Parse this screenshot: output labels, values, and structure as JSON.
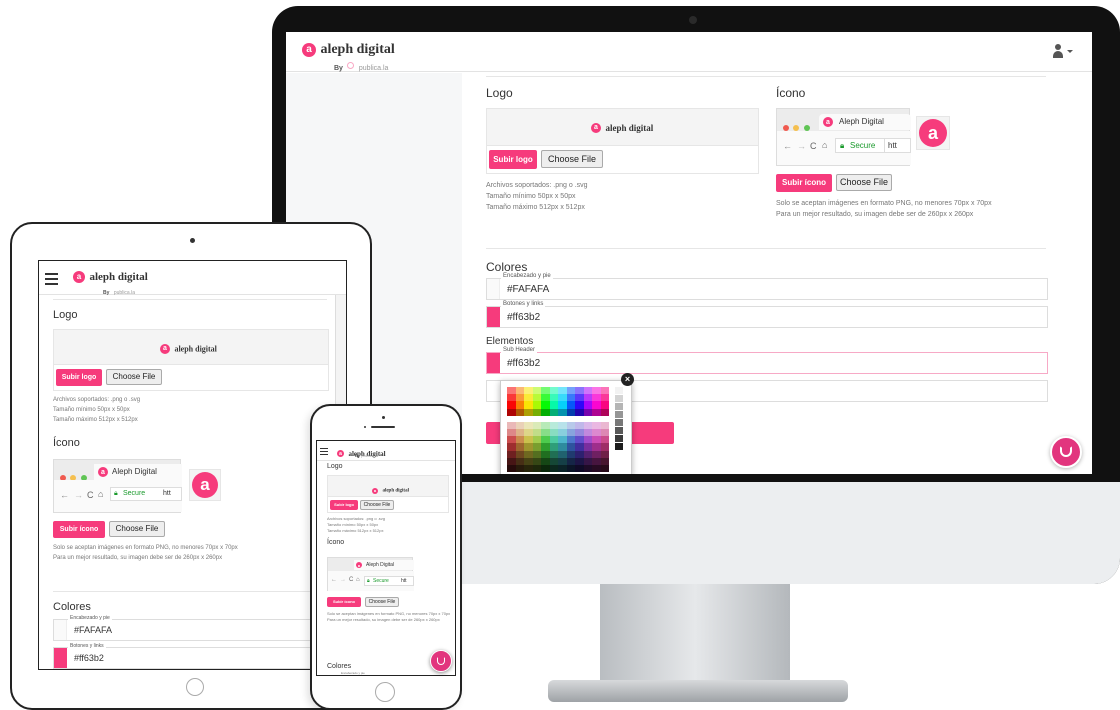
{
  "app": {
    "brand": "aleph digital",
    "by_label": "By",
    "by_company": "publica.la",
    "logo_letter": "a"
  },
  "logo_section": {
    "title": "Logo",
    "upload_button": "Subir logo",
    "file_button": "Choose File",
    "help_lines": [
      "Archivos soportados: .png o .svg",
      "Tamaño mínimo 50px x 50px",
      "Tamaño máximo 512px x 512px"
    ]
  },
  "icon_section": {
    "title": "Ícono",
    "upload_button": "Subir ícono",
    "file_button": "Choose File",
    "help_lines": [
      "Solo se aceptan imágenes en formato PNG, no menores 70px x 70px",
      "Para un mejor resultado, su imagen debe ser de 260px x 260px"
    ],
    "browser_tab_title": "Aleph Digital",
    "secure_label": "Secure",
    "url_fragment": "htt"
  },
  "colors_section": {
    "title": "Colores",
    "fields": [
      {
        "label": "Encabezado y pie",
        "value": "#FAFAFA",
        "swatch": "#FAFAFA"
      },
      {
        "label": "Botones y links",
        "value": "#ff63b2",
        "swatch": "#f63b7c"
      }
    ]
  },
  "elements_section": {
    "title": "Elementos",
    "fields": [
      {
        "label": "Sub Header",
        "value": "#ff63b2",
        "swatch": "#f63b7c"
      }
    ]
  },
  "theme": {
    "accent": "#f63b7c",
    "chat": "#e2357e",
    "secure": "#1a9a2c"
  }
}
